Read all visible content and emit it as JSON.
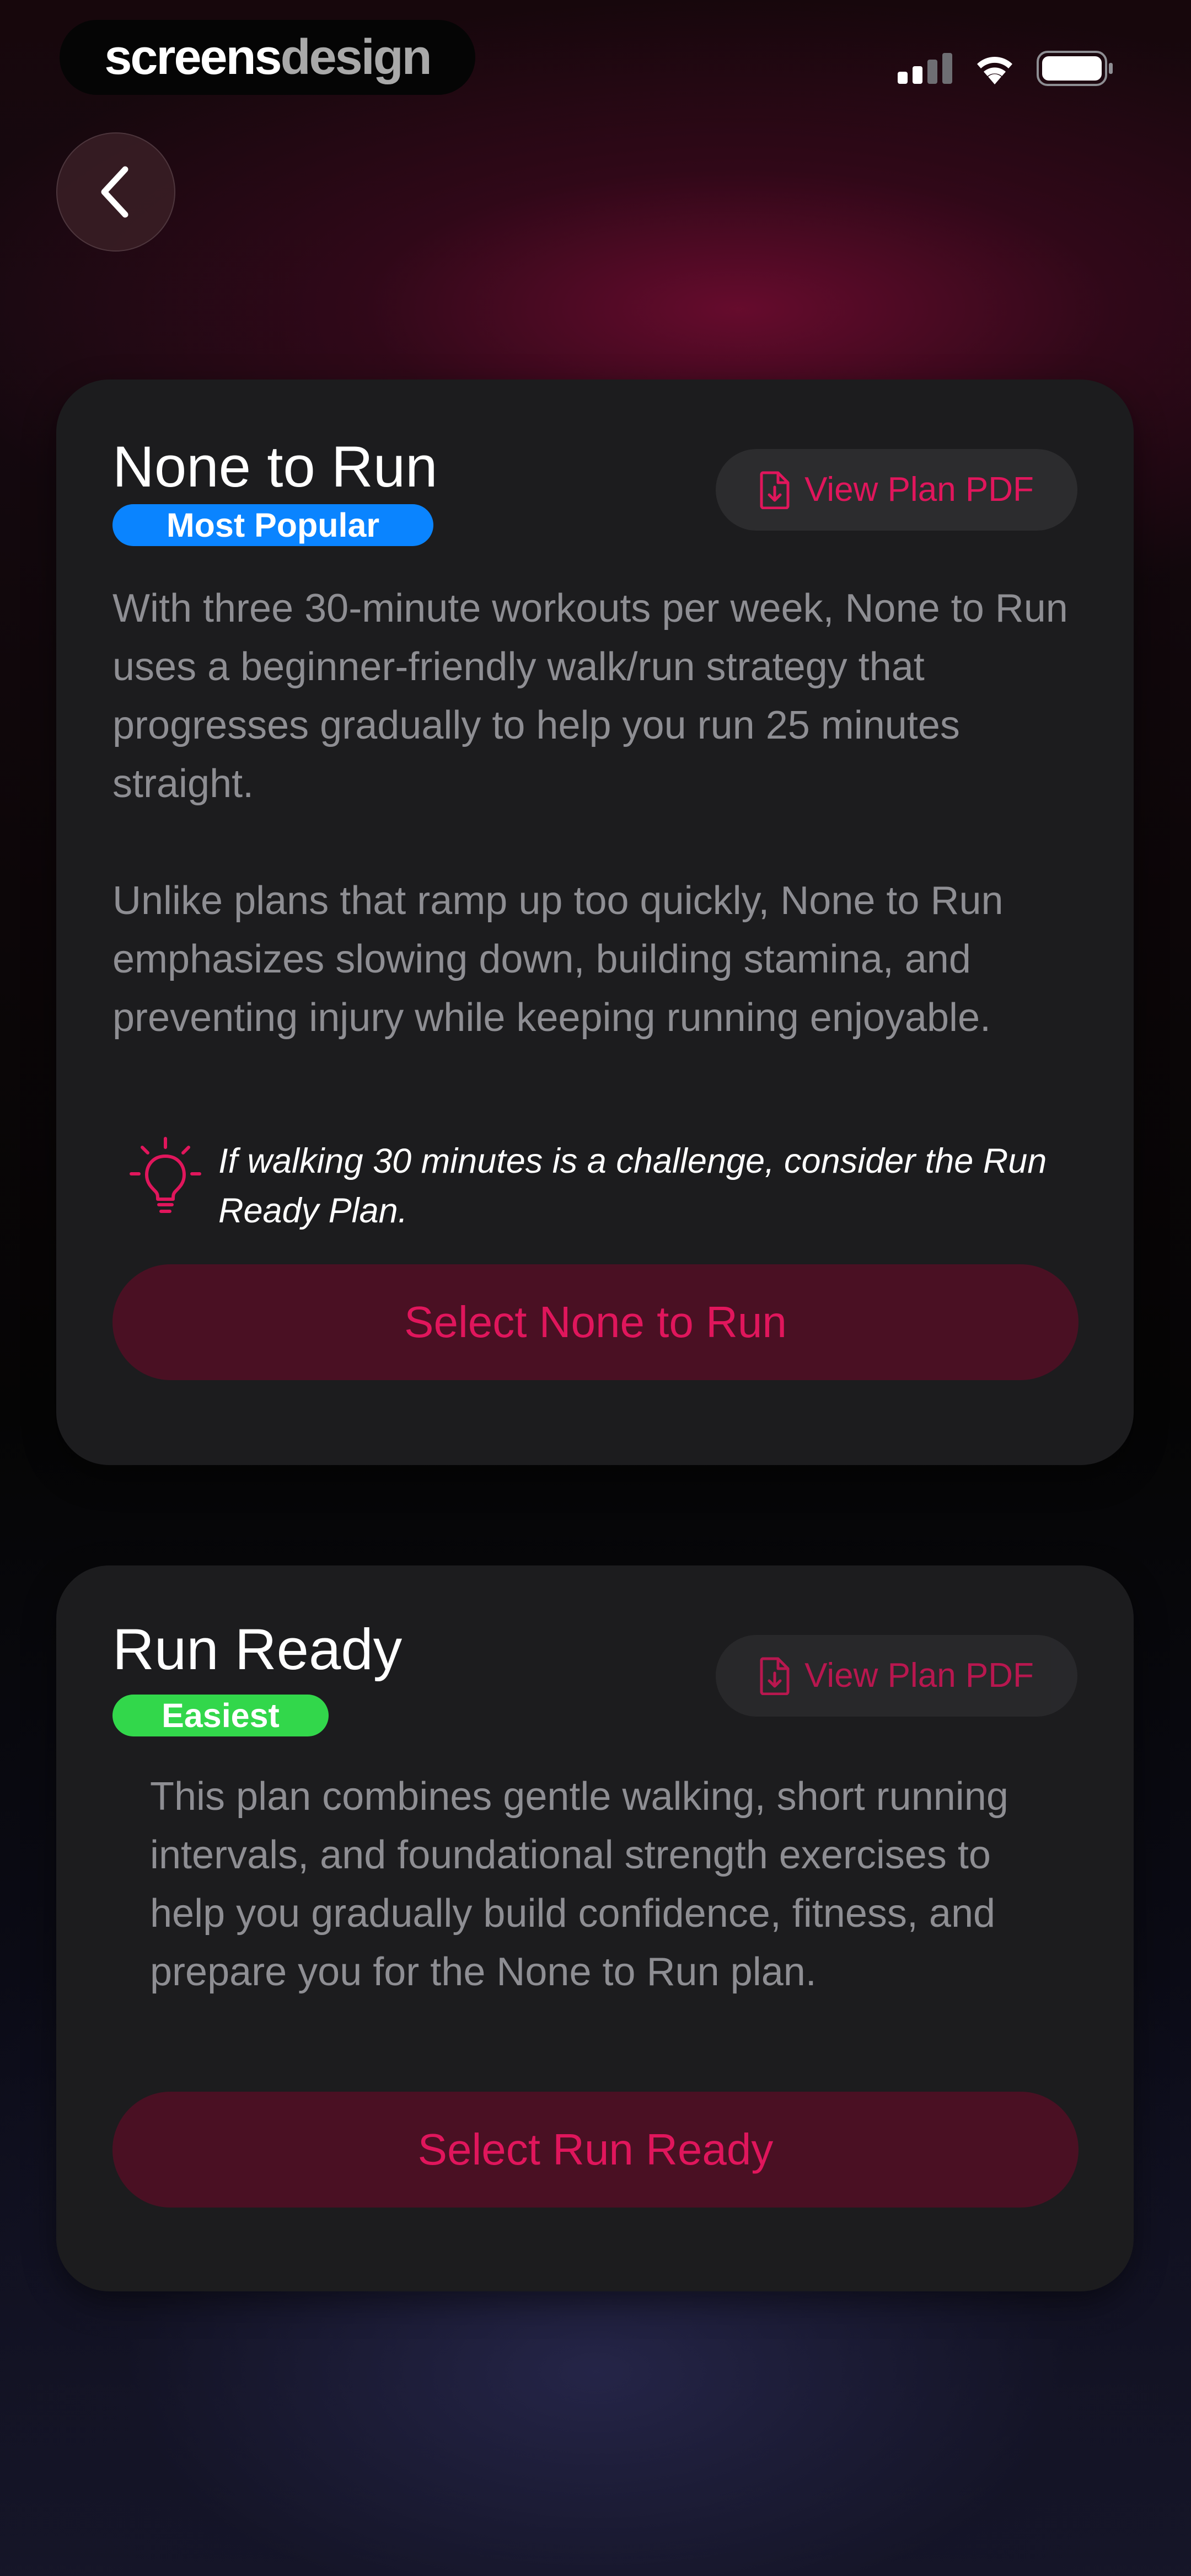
{
  "status_bar": {
    "brand_part_a": "screens",
    "brand_part_b": "design"
  },
  "colors": {
    "accent": "#e0165c",
    "most_popular_badge": "#0a84ff",
    "easiest_badge": "#32d74b",
    "card_background": "#1c1c1e"
  },
  "plans": [
    {
      "title": "None to Run",
      "badge": "Most Popular",
      "pdf_label": "View Plan PDF",
      "description": [
        "With three 30-minute workouts per week, None to Run uses a beginner-friendly walk/run strategy that progresses gradually to help you run 25 minutes straight.",
        "Unlike plans that ramp up too quickly, None to Run emphasizes slowing down, building stamina, and preventing injury while keeping running enjoyable."
      ],
      "tip": "If walking 30 minutes is a challenge, consider the Run Ready Plan.",
      "tip_icon": "lightbulb-icon",
      "select_label": "Select None to Run"
    },
    {
      "title": "Run Ready",
      "badge": "Easiest",
      "pdf_label": "View Plan PDF",
      "description": [
        "This plan combines gentle walking, short running intervals, and foundational strength exercises to help you gradually build confidence, fitness, and prepare you for the None to Run plan."
      ],
      "select_label": "Select Run Ready"
    }
  ]
}
